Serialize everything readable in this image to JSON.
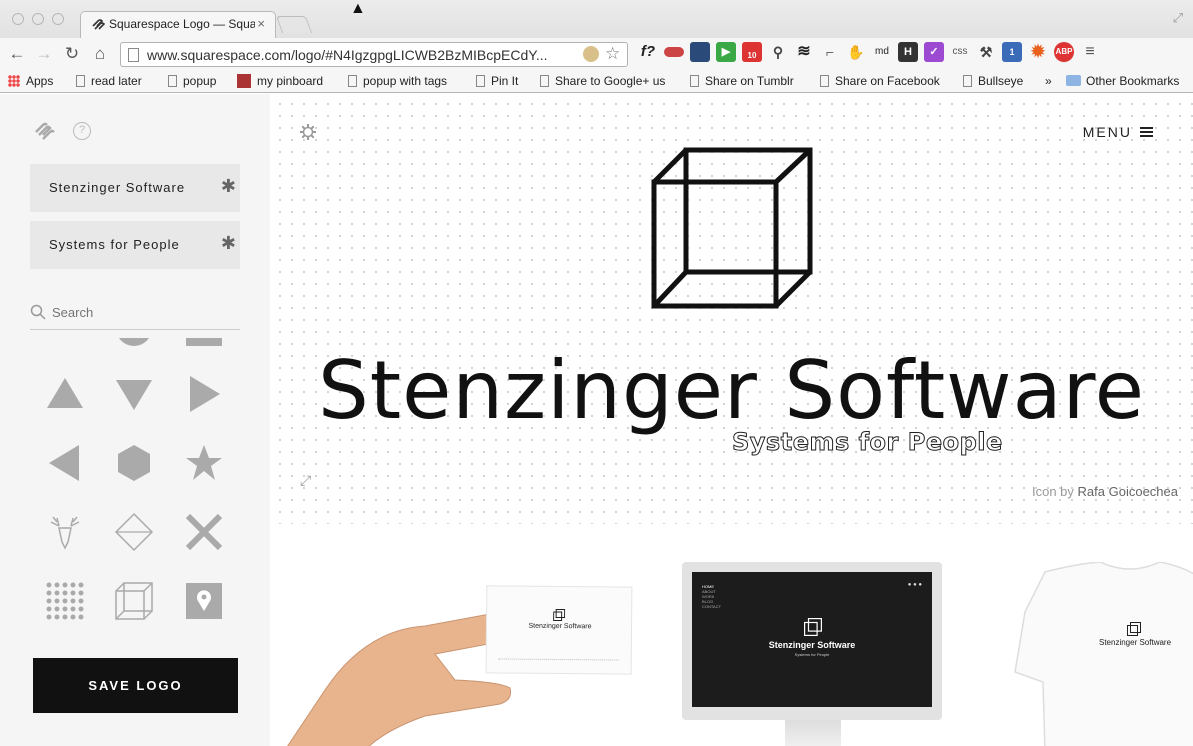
{
  "browser": {
    "tab_title": "Squarespace Logo — Squarespace",
    "tab_close": "×",
    "url": "www.squarespace.com/logo/#N4IgzgpgLICWB2BzMIBcpECdY...",
    "extensions": [
      "f?",
      "mask",
      "box",
      "play",
      "10",
      "bird",
      "layers",
      "pin",
      "evernote",
      "md",
      "H",
      "check",
      "css",
      "tool",
      "1",
      "sun",
      "ABP"
    ],
    "bookmarks": [
      "Apps",
      "read later",
      "popup",
      "my pinboard",
      "popup with tags",
      "Pin It",
      "Share to Google+ us",
      "Share on Tumblr",
      "Share on Facebook",
      "Bullseye",
      "»",
      "Other Bookmarks"
    ]
  },
  "sidebar": {
    "help_label": "?",
    "text_boxes": [
      {
        "label": "Stenzinger Software",
        "icon": "asterisk-icon"
      },
      {
        "label": "Systems for People",
        "icon": "asterisk-icon"
      }
    ],
    "search_placeholder": "Search",
    "icon_grid": [
      "triangle-up",
      "triangle-down",
      "triangle-right",
      "triangle-left",
      "hexagon",
      "star",
      "deer",
      "diamond",
      "x-cross",
      "dot-grid",
      "cube",
      "map-pin"
    ],
    "save_label": "SAVE LOGO"
  },
  "canvas": {
    "menu_label": "MENU",
    "logo_title": "Stenzinger Software",
    "logo_tagline": "Systems for People",
    "credit_prefix": "Icon by",
    "credit_name": "Rafa Goicoechea"
  },
  "mockups": {
    "card_name": "Stenzinger Software",
    "screen_name": "Stenzinger Software",
    "screen_tagline": "Systems for People",
    "screen_nav": [
      "HOME",
      "ABOUT",
      "WORK",
      "BLOG",
      "CONTACT"
    ],
    "shirt_name": "Stenzinger Software"
  },
  "colors": {
    "accent": "#111111",
    "sidebar_bg": "#f5f5f5",
    "textbox_bg": "#e8e8e8"
  }
}
